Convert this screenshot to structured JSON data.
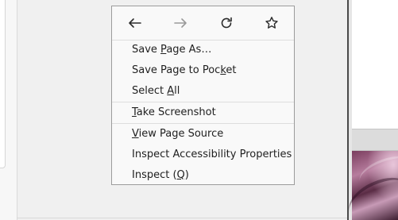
{
  "nav": {
    "back_icon": "arrow-left-icon",
    "forward_icon": "arrow-right-icon",
    "reload_icon": "reload-icon",
    "bookmark_icon": "star-icon"
  },
  "menu": {
    "items": [
      {
        "pre": "Save ",
        "key": "P",
        "post": "age As…"
      },
      {
        "pre": "Save Page to Poc",
        "key": "k",
        "post": "et"
      },
      {
        "pre": "Select ",
        "key": "A",
        "post": "ll"
      },
      {
        "pre": "",
        "key": "T",
        "post": "ake Screenshot"
      },
      {
        "pre": "",
        "key": "V",
        "post": "iew Page Source"
      },
      {
        "pre": "Inspect Accessibility Properties",
        "key": "",
        "post": ""
      },
      {
        "pre": "Inspect (",
        "key": "Q",
        "post": ")"
      }
    ]
  },
  "colors": {
    "menu_bg": "#f9f9f9",
    "menu_border": "#9c9c9c",
    "text": "#1f1f1f",
    "disabled_icon": "#9a9a9a"
  }
}
